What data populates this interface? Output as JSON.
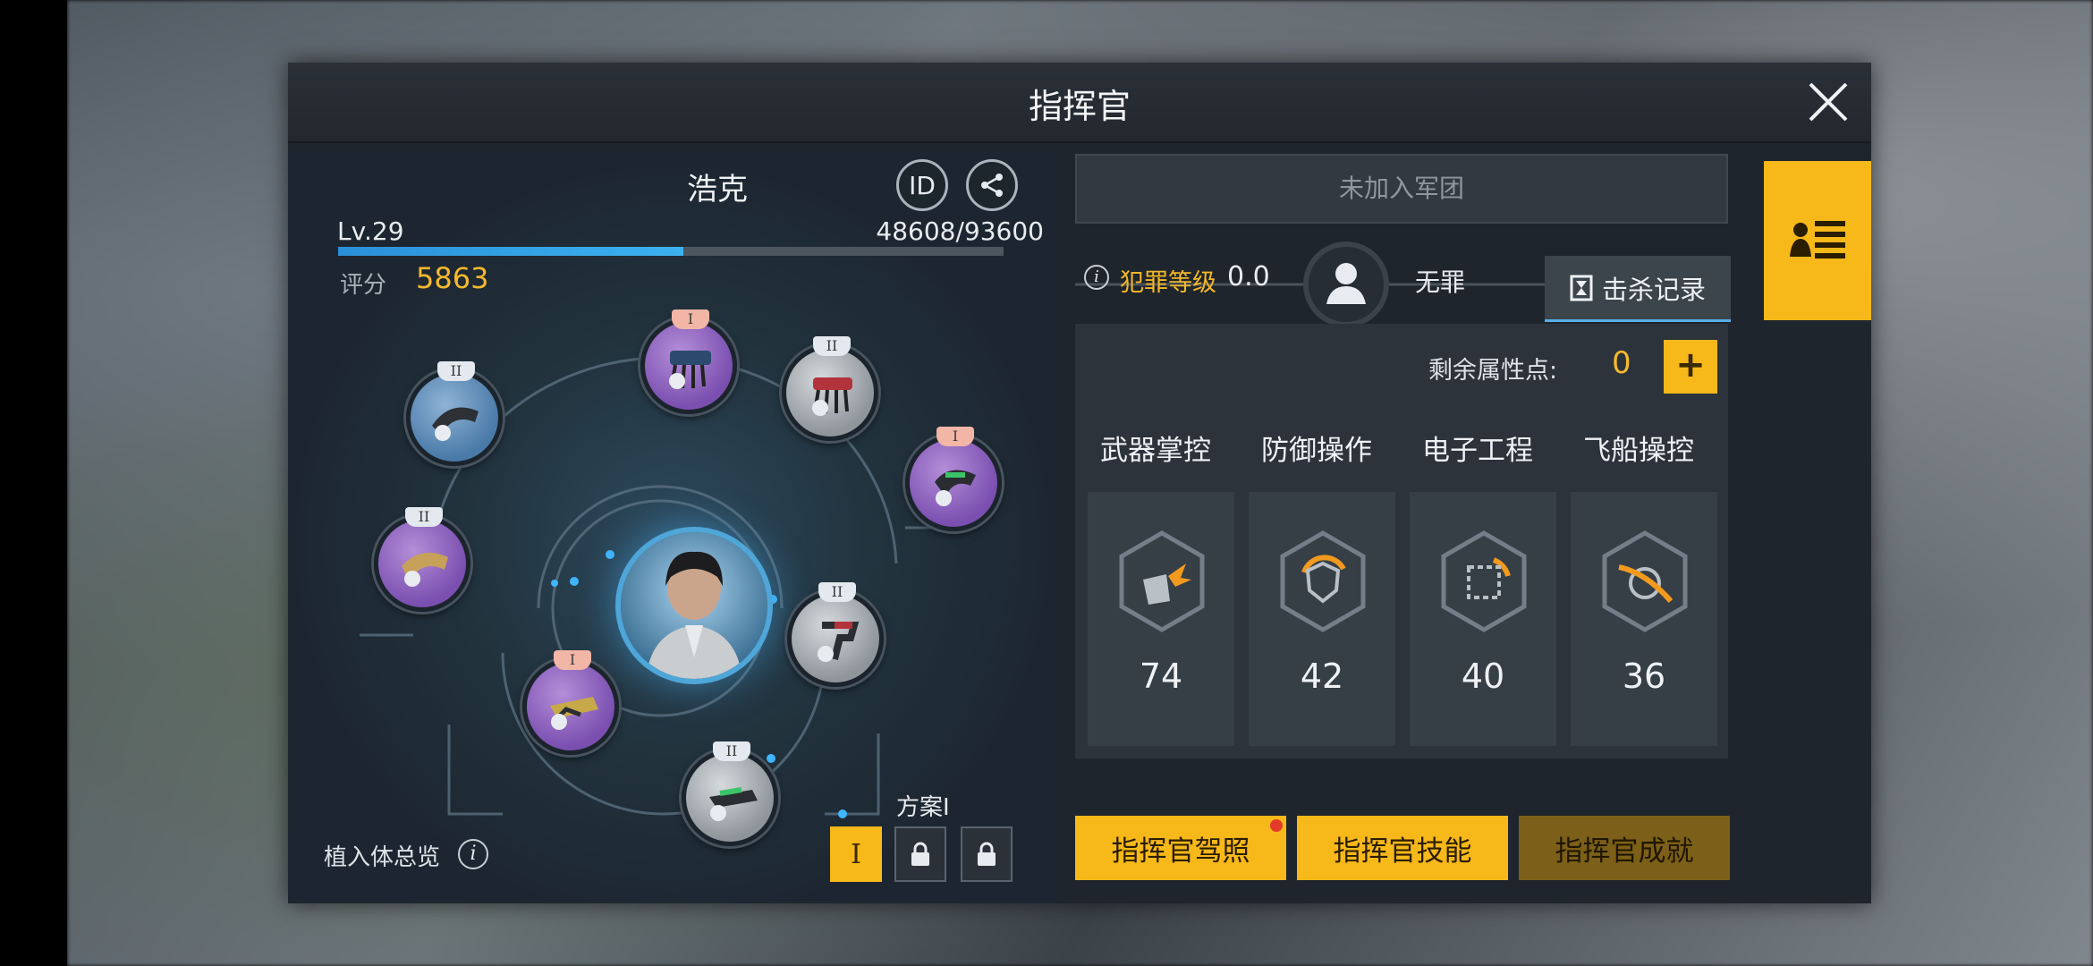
{
  "window": {
    "title": "指挥官"
  },
  "profile": {
    "name": "浩克",
    "id_button": "ID",
    "level": "Lv.29",
    "exp_text": "48608/93600",
    "exp_fraction": 0.519,
    "score_label": "评分",
    "score": "5863"
  },
  "implants": {
    "slots": [
      {
        "tier": "II",
        "color": "blue"
      },
      {
        "tier": "I",
        "color": "purple"
      },
      {
        "tier": "II",
        "color": "grey"
      },
      {
        "tier": "I",
        "color": "purple"
      },
      {
        "tier": "II",
        "color": "purple"
      },
      {
        "tier": "II",
        "color": "grey"
      },
      {
        "tier": "I",
        "color": "purple"
      },
      {
        "tier": "II",
        "color": "grey"
      }
    ],
    "overview_label": "植入体总览",
    "plan_label": "方案I",
    "plan_buttons": [
      "I",
      "lock-icon",
      "lock-icon"
    ]
  },
  "legion": {
    "status": "未加入军团"
  },
  "crime": {
    "label": "犯罪等级",
    "value": "0.0",
    "status": "无罪",
    "kill_record": "击杀记录"
  },
  "attributes": {
    "remaining_label": "剩余属性点:",
    "remaining_value": "0",
    "items": [
      {
        "name": "武器掌控",
        "value": "74",
        "icon": "weapon-icon"
      },
      {
        "name": "防御操作",
        "value": "42",
        "icon": "shield-icon"
      },
      {
        "name": "电子工程",
        "value": "40",
        "icon": "chip-icon"
      },
      {
        "name": "飞船操控",
        "value": "36",
        "icon": "ship-icon"
      }
    ]
  },
  "buttons": {
    "license": "指挥官驾照",
    "skills": "指挥官技能",
    "achievements": "指挥官成就"
  },
  "colors": {
    "accent": "#f7b81a",
    "score": "#f5b92d",
    "crime": "#f2b729"
  }
}
